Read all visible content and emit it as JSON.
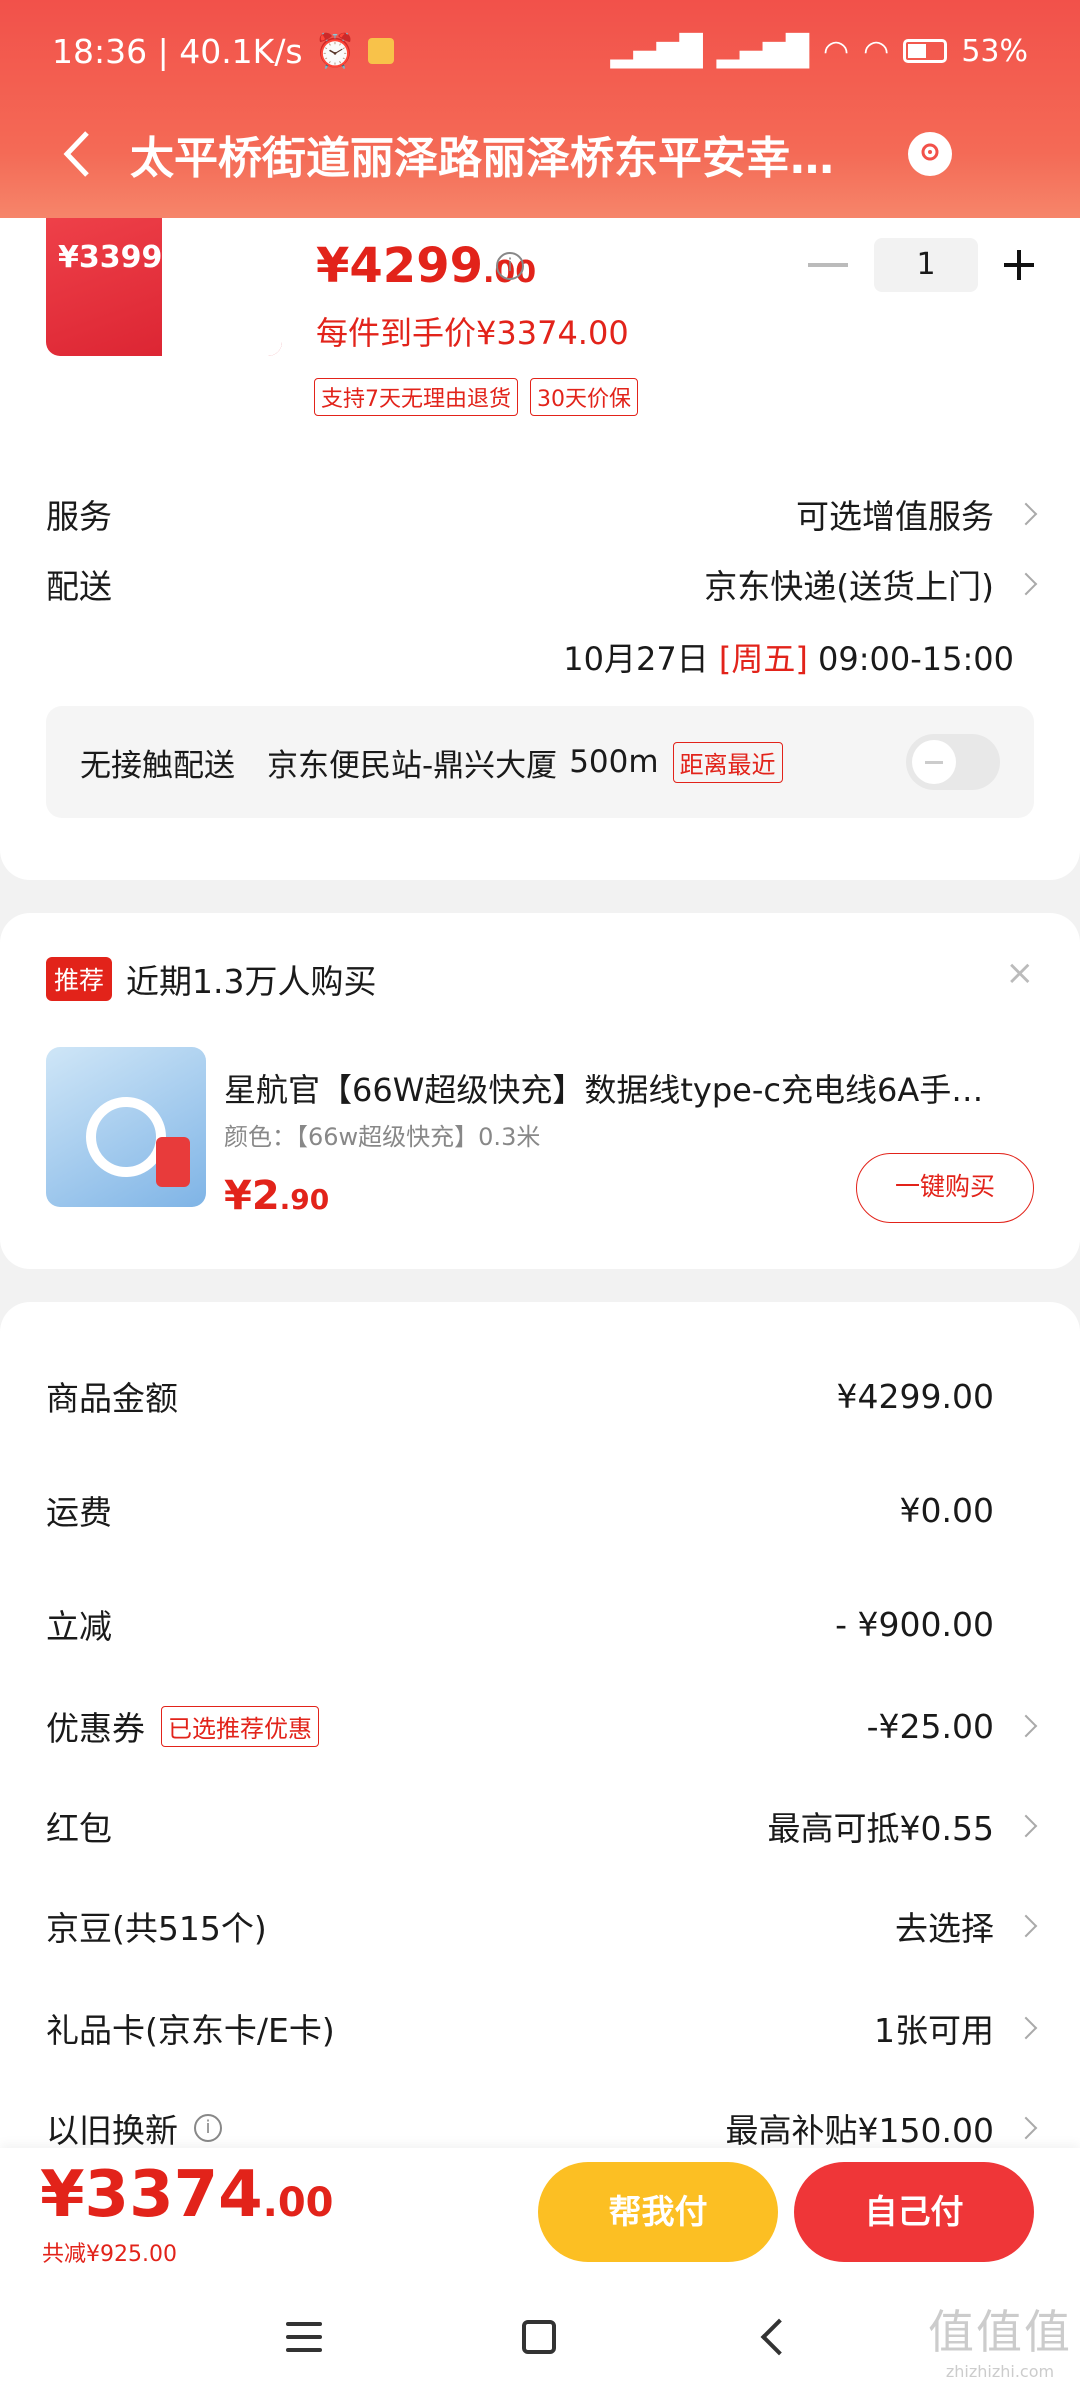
{
  "status_bar": {
    "time_speed": "18:36 | 40.1K/s",
    "battery": "53%"
  },
  "header": {
    "address": "太平桥街道丽泽路丽泽桥东平安幸…"
  },
  "product": {
    "thumb_price": "¥3399",
    "price_main": "¥4299",
    "price_cents": ".00",
    "quantity": "1",
    "per_item_price": "每件到手价¥3374.00",
    "tags": [
      "支持7天无理由退货",
      "30天价保"
    ]
  },
  "service": {
    "label": "服务",
    "value": "可选增值服务"
  },
  "delivery": {
    "label": "配送",
    "method": "京东快递(送货上门)",
    "date": "10月27日",
    "weekday": "[周五]",
    "time": "09:00-15:00",
    "contactless_label": "无接触配送",
    "station": "京东便民站-鼎兴大厦",
    "distance": "500m",
    "nearest_tag": "距离最近"
  },
  "recommend": {
    "badge": "推荐",
    "headline": "近期1.3万人购买",
    "close": "×",
    "title": "星航官【66W超级快充】数据线type-c充电线6A手…",
    "spec": "颜色：【66w超级快充】0.3米",
    "price_main": "¥2",
    "price_cents": ".90",
    "buy_label": "一键购买"
  },
  "summary": {
    "goods_label": "商品金额",
    "goods_value": "¥4299.00",
    "shipping_label": "运费",
    "shipping_value": "¥0.00",
    "discount_label": "立减",
    "discount_value": "- ¥900.00",
    "coupon_label": "优惠券",
    "coupon_tag": "已选推荐优惠",
    "coupon_value": "-¥25.00",
    "redpacket_label": "红包",
    "redpacket_value": "最高可抵¥0.55",
    "jingdou_label": "京豆(共515个)",
    "jingdou_value": "去选择",
    "giftcard_label": "礼品卡(京东卡/E卡)",
    "giftcard_value": "1张可用",
    "tradein_label": "以旧换新",
    "tradein_value": "最高补贴¥150.00"
  },
  "bottom_bar": {
    "total_main": "¥3374",
    "total_cents": ".00",
    "saved": "共减¥925.00",
    "help_pay": "帮我付",
    "self_pay": "自己付"
  },
  "watermark": {
    "line1": "值值值",
    "line2": "zhizhizhi.com"
  },
  "colors": {
    "accent_red": "#e2231a",
    "pay_yellow": "#fcbf23",
    "pay_red": "#ef3638"
  }
}
